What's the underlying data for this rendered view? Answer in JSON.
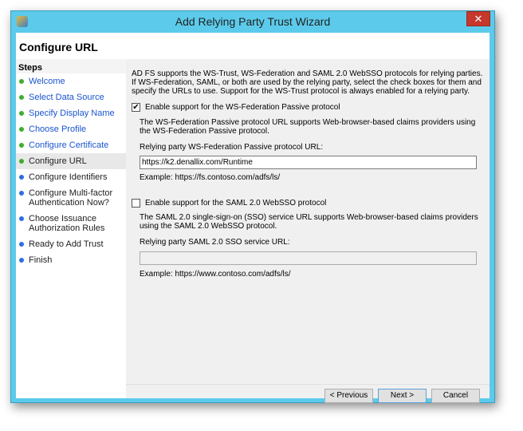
{
  "window": {
    "title": "Add Relying Party Trust Wizard",
    "close": "✕"
  },
  "header": {
    "title": "Configure URL"
  },
  "steps": {
    "heading": "Steps",
    "items": [
      {
        "label": "Welcome",
        "state": "done"
      },
      {
        "label": "Select Data Source",
        "state": "done"
      },
      {
        "label": "Specify Display Name",
        "state": "done"
      },
      {
        "label": "Choose Profile",
        "state": "done"
      },
      {
        "label": "Configure Certificate",
        "state": "done"
      },
      {
        "label": "Configure URL",
        "state": "current"
      },
      {
        "label": "Configure Identifiers",
        "state": "todo"
      },
      {
        "label": "Configure Multi-factor Authentication Now?",
        "state": "todo"
      },
      {
        "label": "Choose Issuance Authorization Rules",
        "state": "todo"
      },
      {
        "label": "Ready to Add Trust",
        "state": "todo"
      },
      {
        "label": "Finish",
        "state": "todo"
      }
    ]
  },
  "main": {
    "intro": "AD FS supports the WS-Trust, WS-Federation and SAML 2.0 WebSSO protocols for relying parties.  If WS-Federation, SAML, or both are used by the relying party, select the check boxes for them and specify the URLs to use.  Support for the WS-Trust protocol is always enabled for a relying party.",
    "wsfed": {
      "checkbox_label": "Enable support for the WS-Federation Passive protocol",
      "checked": true,
      "description": "The WS-Federation Passive protocol URL supports Web-browser-based claims providers using the WS-Federation Passive protocol.",
      "field_label": "Relying party WS-Federation Passive protocol URL:",
      "value": "https://k2.denallix.com/Runtime",
      "example": "Example: https://fs.contoso.com/adfs/ls/"
    },
    "saml": {
      "checkbox_label": "Enable support for the SAML 2.0 WebSSO protocol",
      "checked": false,
      "description": "The SAML 2.0 single-sign-on (SSO) service URL supports Web-browser-based claims providers using the SAML 2.0 WebSSO protocol.",
      "field_label": "Relying party SAML 2.0 SSO service URL:",
      "value": "",
      "example": "Example: https://www.contoso.com/adfs/ls/"
    }
  },
  "buttons": {
    "previous": "< Previous",
    "next": "Next >",
    "cancel": "Cancel"
  }
}
